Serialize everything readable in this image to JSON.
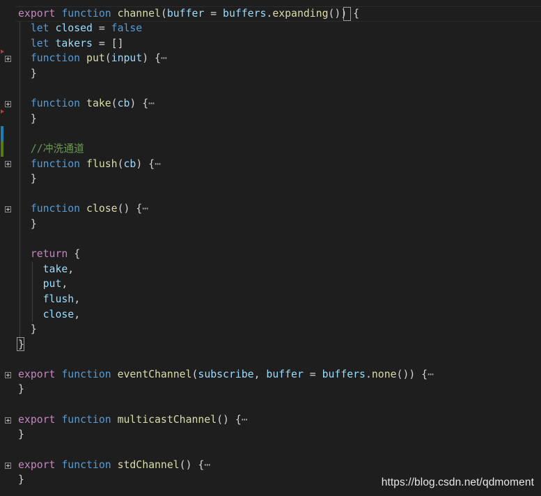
{
  "code": {
    "line1": {
      "export": "export",
      "function": "function",
      "name": "channel",
      "open": "(",
      "param": "buffer",
      "eq": " = ",
      "obj": "buffers",
      "dot": ".",
      "method": "expanding",
      "close": "()) ",
      "brace": "{"
    },
    "line2": {
      "kw": "let",
      "name": "closed",
      "eq": " = ",
      "val": "false"
    },
    "line3": {
      "kw": "let",
      "name": "takers",
      "rest": " = []"
    },
    "line4": {
      "kw": "function",
      "name": "put",
      "open": "(",
      "param": "input",
      "close": ") {",
      "ellipsis": "⋯"
    },
    "line5": {
      "text": "}"
    },
    "line6": {
      "kw": "function",
      "name": "take",
      "open": "(",
      "param": "cb",
      "close": ") {",
      "ellipsis": "⋯"
    },
    "line7": {
      "text": "}"
    },
    "line8": {
      "text": "//冲洗通道"
    },
    "line9": {
      "kw": "function",
      "name": "flush",
      "open": "(",
      "param": "cb",
      "close": ") {",
      "ellipsis": "⋯"
    },
    "line10": {
      "text": "}"
    },
    "line11": {
      "kw": "function",
      "name": "close",
      "close": "() {",
      "ellipsis": "⋯"
    },
    "line12": {
      "text": "}"
    },
    "line13": {
      "kw": "return",
      "rest": " {"
    },
    "line14": {
      "name": "take",
      "comma": ","
    },
    "line15": {
      "name": "put",
      "comma": ","
    },
    "line16": {
      "name": "flush",
      "comma": ","
    },
    "line17": {
      "name": "close",
      "comma": ","
    },
    "line18": {
      "text": "}"
    },
    "line19": {
      "text": "}"
    },
    "line20": {
      "export": "export",
      "function": "function",
      "name": "eventChannel",
      "open": "(",
      "p1": "subscribe",
      "sep": ", ",
      "p2": "buffer",
      "eq": " = ",
      "obj": "buffers",
      "dot": ".",
      "method": "none",
      "close": "()) {",
      "ellipsis": "⋯"
    },
    "line21": {
      "text": "}"
    },
    "line22": {
      "export": "export",
      "function": "function",
      "name": "multicastChannel",
      "close": "() {",
      "ellipsis": "⋯"
    },
    "line23": {
      "text": "}"
    },
    "line24": {
      "export": "export",
      "function": "function",
      "name": "stdChannel",
      "close": "() {",
      "ellipsis": "⋯"
    },
    "line25": {
      "text": "}"
    }
  },
  "watermark": "https://blog.csdn.net/qdmoment",
  "colors": {
    "background": "#1e1e1e",
    "keyword_export": "#c586c0",
    "keyword_storage": "#569cd6",
    "function_name": "#dcdcaa",
    "variable": "#9cdcfe",
    "comment": "#6a9955",
    "text": "#d4d4d4"
  },
  "gutter_icons": {
    "fold": "plus-box-icon",
    "breakpoint": "red-triangle-marker-icon"
  }
}
